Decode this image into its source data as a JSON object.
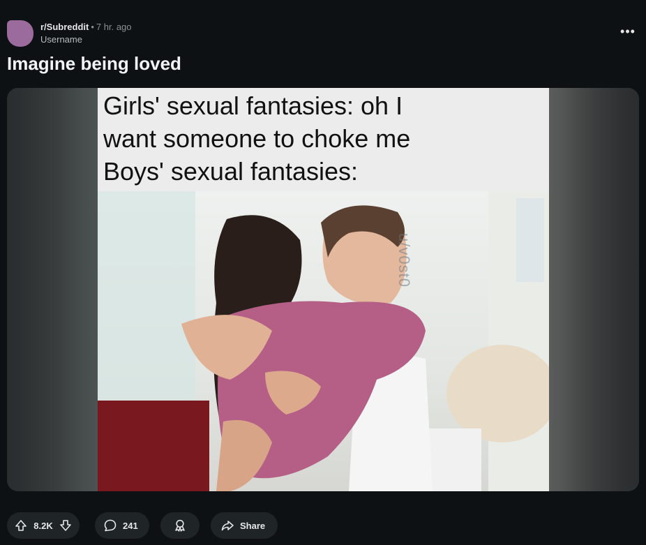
{
  "post": {
    "subreddit": "r/Subreddit",
    "separator": "•",
    "time_ago": "7 hr. ago",
    "username": "Username",
    "more_label": "•••",
    "title": "Imagine being loved",
    "meme": {
      "caption_lines": [
        "Girls' sexual fantasies: oh I",
        "want someone to choke me",
        "Boys' sexual fantasies:"
      ],
      "watermark": "u/v0st0"
    },
    "actions": {
      "upvotes": "8.2K",
      "comments": "241",
      "share_label": "Share"
    }
  },
  "colors": {
    "background": "#0e1113",
    "avatar": "#9b6b9d",
    "pill": "#1f2426",
    "sweater": "#b55f86",
    "shirt": "#f5f5f5",
    "hair_dark": "#2a1e1b"
  },
  "icons": {
    "upvote": "arrow-up-outline-icon",
    "downvote": "arrow-down-outline-icon",
    "comment": "speech-bubble-icon",
    "award": "award-ribbon-icon",
    "share": "share-arrow-icon",
    "more": "horizontal-ellipsis-icon"
  }
}
